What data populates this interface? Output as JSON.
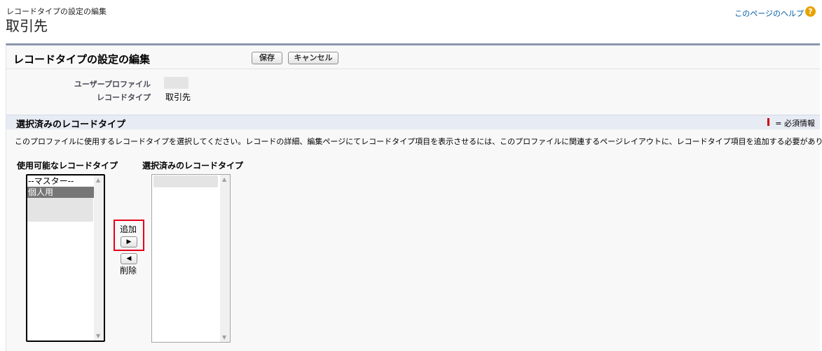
{
  "header": {
    "subtitle": "レコードタイプの設定の編集",
    "title": "取引先",
    "help_link": "このページのヘルプ",
    "help_icon": "?"
  },
  "panel": {
    "title": "レコードタイプの設定の編集",
    "save_label": "保存",
    "cancel_label": "キャンセル"
  },
  "fields": {
    "profile_label": "ユーザープロファイル",
    "record_type_label": "レコードタイプ",
    "record_type_value": "取引先"
  },
  "section": {
    "title": "選択済みのレコードタイプ",
    "required_label": "= 必須情報",
    "description": "このプロファイルに使用するレコードタイプを選択してください。レコードの詳細、編集ページにてレコードタイプ項目を表示させるには、このプロファイルに関連するページレイアウトに、レコードタイプ項目を追加する必要があります。"
  },
  "available": {
    "label": "使用可能なレコードタイプ",
    "options": [
      "--マスター--",
      "個人用"
    ]
  },
  "selected": {
    "label": "選択済みのレコードタイプ"
  },
  "controls": {
    "add_label": "追加",
    "remove_label": "削除",
    "add_icon": "▶",
    "remove_icon": "◀"
  },
  "colors": {
    "accent_border": "#8b97ad",
    "section_bg": "#e7ebf3",
    "highlight": "#e4001b",
    "link": "#015ba7",
    "help_icon": "#e8a201"
  }
}
